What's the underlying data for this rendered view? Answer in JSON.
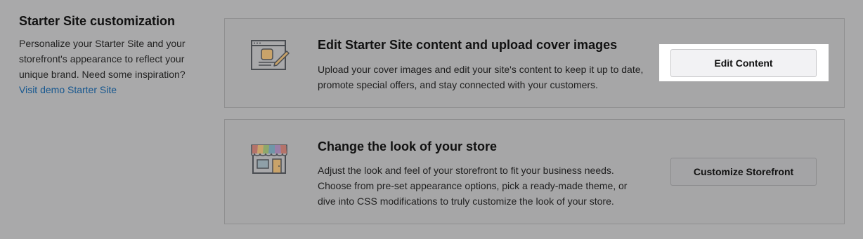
{
  "section": {
    "title": "Starter Site customization",
    "description": "Personalize your Starter Site and your storefront's appearance to reflect your unique brand. Need some inspiration?",
    "link": "Visit demo Starter Site"
  },
  "cards": [
    {
      "title": "Edit Starter Site content and upload cover images",
      "description": "Upload your cover images and edit your site's content to keep it up to date, promote special offers, and stay connected with your customers.",
      "button": "Edit Content",
      "icon": "browser-edit-icon"
    },
    {
      "title": "Change the look of your store",
      "description": "Adjust the look and feel of your storefront to fit your business needs. Choose from pre-set appearance options, pick a ready-made theme, or dive into CSS modifications to truly customize the look of your store.",
      "button": "Customize Storefront",
      "icon": "storefront-icon"
    }
  ],
  "colors": {
    "overlay": "#a9a9aa",
    "link": "#16578f",
    "highlight": "#ffffff"
  }
}
